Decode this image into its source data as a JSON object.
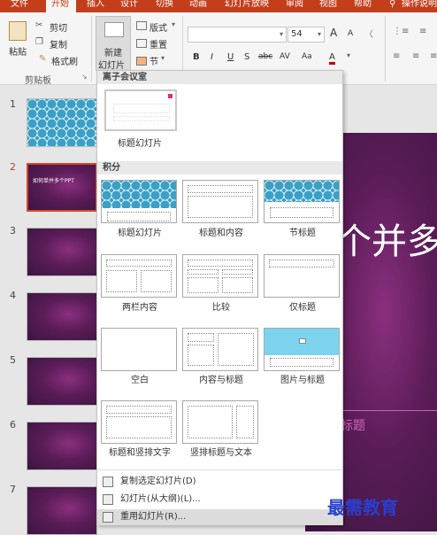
{
  "ribbon_tabs": [
    "文件",
    "开始",
    "插入",
    "设计",
    "切换",
    "动画",
    "幻灯片放映",
    "审阅",
    "视图",
    "帮助",
    "操作说明"
  ],
  "clipboard": {
    "paste": "粘贴",
    "cut": "剪切",
    "copy": "复制",
    "format_painter": "格式刷",
    "group_label": "剪贴板"
  },
  "slides_group": {
    "new_slide_line1": "新建",
    "new_slide_line2": "幻灯片",
    "layout": "版式",
    "reset": "重置",
    "section": "节"
  },
  "font": {
    "size": "54",
    "grow": "A",
    "shrink": "A",
    "bold": "B",
    "italic": "I",
    "underline": "U",
    "strike": "S",
    "shadow": "abc",
    "spacing": "AV",
    "case": "Aa",
    "color": "A"
  },
  "thumbnails": {
    "numbers": [
      "1",
      "2",
      "3",
      "4",
      "5",
      "6",
      "7"
    ],
    "slide2_text": "如何单并多个PPT"
  },
  "slide": {
    "title_fragment": "个并多",
    "subtitle_fragment": "标题"
  },
  "dropdown": {
    "section1": "离子会议室",
    "section1_layout": "标题幻灯片",
    "section2": "积分",
    "layouts": [
      "标题幻灯片",
      "标题和内容",
      "节标题",
      "两栏内容",
      "比较",
      "仅标题",
      "空白",
      "内容与标题",
      "图片与标题",
      "标题和竖排文字",
      "竖排标题与文本"
    ],
    "menu": [
      "复制选定幻灯片(D)",
      "幻灯片(从大纲)(L)...",
      "重用幻灯片(R)..."
    ]
  },
  "watermark": "最需教育"
}
